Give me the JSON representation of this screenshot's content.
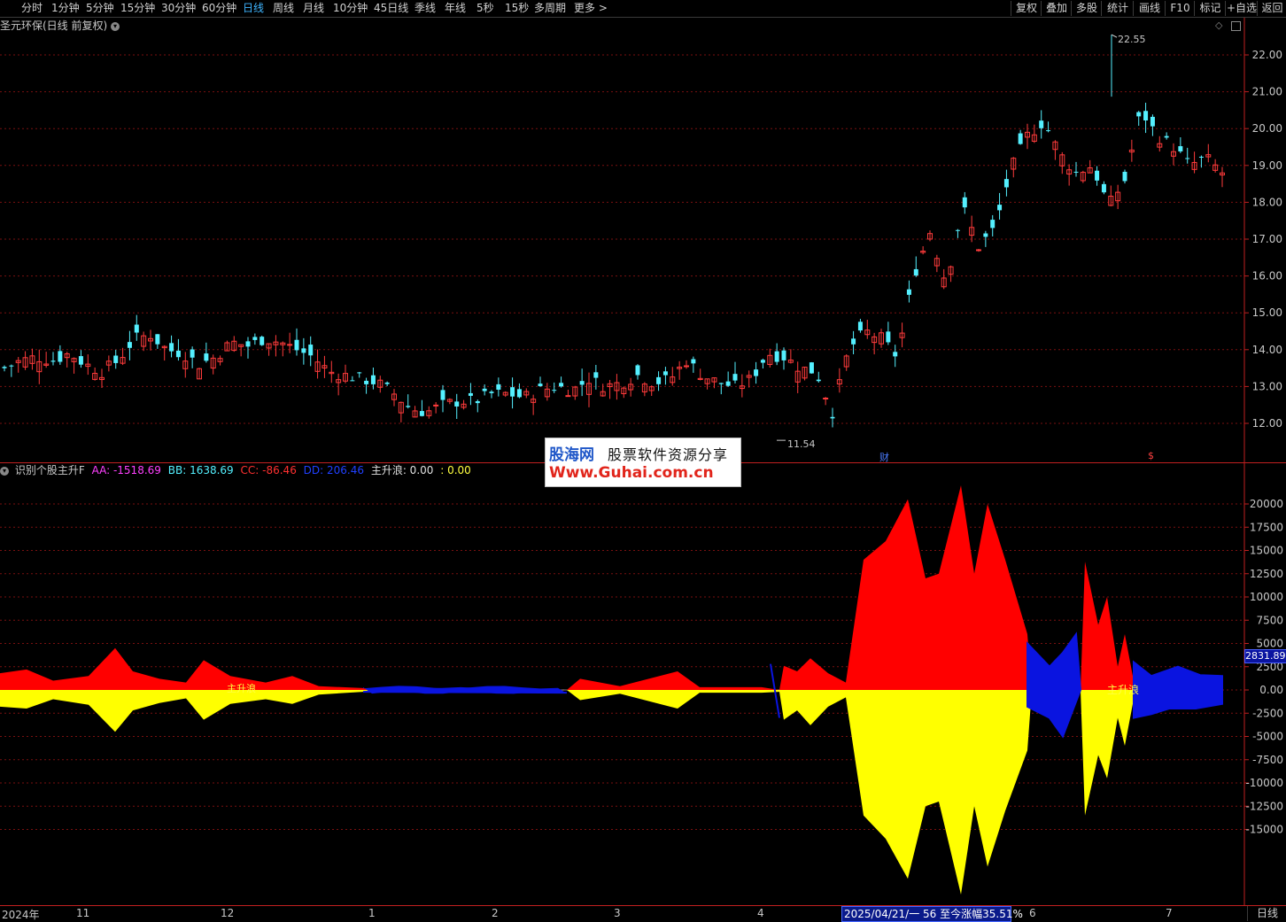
{
  "toolbar": {
    "periods": [
      "分时",
      "1分钟",
      "5分钟",
      "15分钟",
      "30分钟",
      "60分钟",
      "日线",
      "周线",
      "月线",
      "10分钟",
      "45日线",
      "季线",
      "年线",
      "5秒",
      "15秒",
      "多周期",
      "更多 >"
    ],
    "active": "日线",
    "right_buttons": [
      "复权",
      "叠加",
      "多股",
      "统计",
      "画线",
      "F10",
      "标记",
      "+自选",
      "返回"
    ]
  },
  "main_panel": {
    "title": "圣元环保(日线 前复权)",
    "high_label": "22.55",
    "low_label": "11.54",
    "marker_cai": "财",
    "marker_dollar": "$",
    "price_ticks": [
      "22.00",
      "21.00",
      "20.00",
      "19.00",
      "18.00",
      "17.00",
      "16.00",
      "15.00",
      "14.00",
      "13.00",
      "12.00"
    ]
  },
  "indicator_panel": {
    "name": "识别个股主升F",
    "aa": "AA: -1518.69",
    "bb": "BB: 1638.69",
    "cc": "CC: -86.46",
    "dd": "DD: 206.46",
    "zsl": "主升浪: 0.00",
    "extra": ": 0.00",
    "value_ticks": [
      "20000",
      "17500",
      "15000",
      "12500",
      "10000",
      "7500",
      "5000",
      "2500",
      "0.00",
      "-2500",
      "-5000",
      "-7500",
      "-10000",
      "-12500",
      "-15000"
    ],
    "current_value": "2831.89",
    "zsl_mark": "主升浪",
    "zsl_mark_early": "主升浪"
  },
  "watermark": {
    "line1_brand": "股海网",
    "line1_text": "股票软件资源分享",
    "line2": "Www.Guhai.com.cn"
  },
  "x_axis": {
    "labels": [
      "2024年",
      "11",
      "12",
      "1",
      "2",
      "3",
      "4",
      "6",
      "7"
    ],
    "cursor_date": "2025/04/21/一 56 至今涨幅35.51%",
    "period": "日线"
  },
  "colors": {
    "up": "#ff3b3b",
    "down": "#54f0ff",
    "red_fill": "#ff0000",
    "yellow_fill": "#ffff00",
    "blue_fill": "#0a14e0"
  },
  "chart_data": [
    {
      "type": "candlestick",
      "title": "圣元环保(日线 前复权)",
      "ylim": [
        11.5,
        22.6
      ],
      "high": 22.55,
      "low": 11.54,
      "close_trend": [
        13.5,
        13.7,
        13.8,
        13.7,
        13.9,
        13.6,
        13.4,
        13.7,
        14.3,
        14.4,
        14.0,
        13.9,
        13.6,
        13.8,
        14.2,
        14.1,
        14.3,
        14.2,
        14.0,
        13.8,
        13.4,
        13.3,
        13.2,
        13.1,
        12.8,
        12.4,
        12.3,
        12.5,
        12.6,
        12.6,
        12.8,
        12.8,
        12.7,
        12.9,
        13.0,
        12.9,
        13.2,
        13.0,
        13.1,
        13.3,
        13.1,
        13.2,
        13.7,
        13.3,
        13.1,
        13.0,
        13.2,
        13.9,
        13.8,
        13.5,
        13.4,
        12.3,
        14.0,
        14.5,
        14.3,
        13.8,
        16.0,
        17.2,
        15.8,
        17.9,
        16.8,
        17.3,
        18.9,
        19.8,
        20.2,
        19.3,
        18.8,
        19.0,
        17.9,
        18.6,
        20.5,
        19.8,
        19.5,
        19.0,
        19.2,
        18.8
      ],
      "price_ticks": [
        22,
        21,
        20,
        19,
        18,
        17,
        16,
        15,
        14,
        13,
        12
      ]
    },
    {
      "type": "area",
      "title": "识别个股主升F",
      "ylim": [
        -20000,
        22500
      ],
      "series": [
        {
          "name": "AA",
          "color": "#ff0000"
        },
        {
          "name": "BB",
          "color": "#ffff00"
        },
        {
          "name": "CC",
          "color": "#0a14e0"
        },
        {
          "name": "DD",
          "color": "#0a14e0"
        }
      ],
      "value_ticks": [
        20000,
        17500,
        15000,
        12500,
        10000,
        7500,
        5000,
        2500,
        0,
        -2500,
        -5000,
        -7500,
        -10000,
        -12500,
        -15000
      ]
    }
  ]
}
